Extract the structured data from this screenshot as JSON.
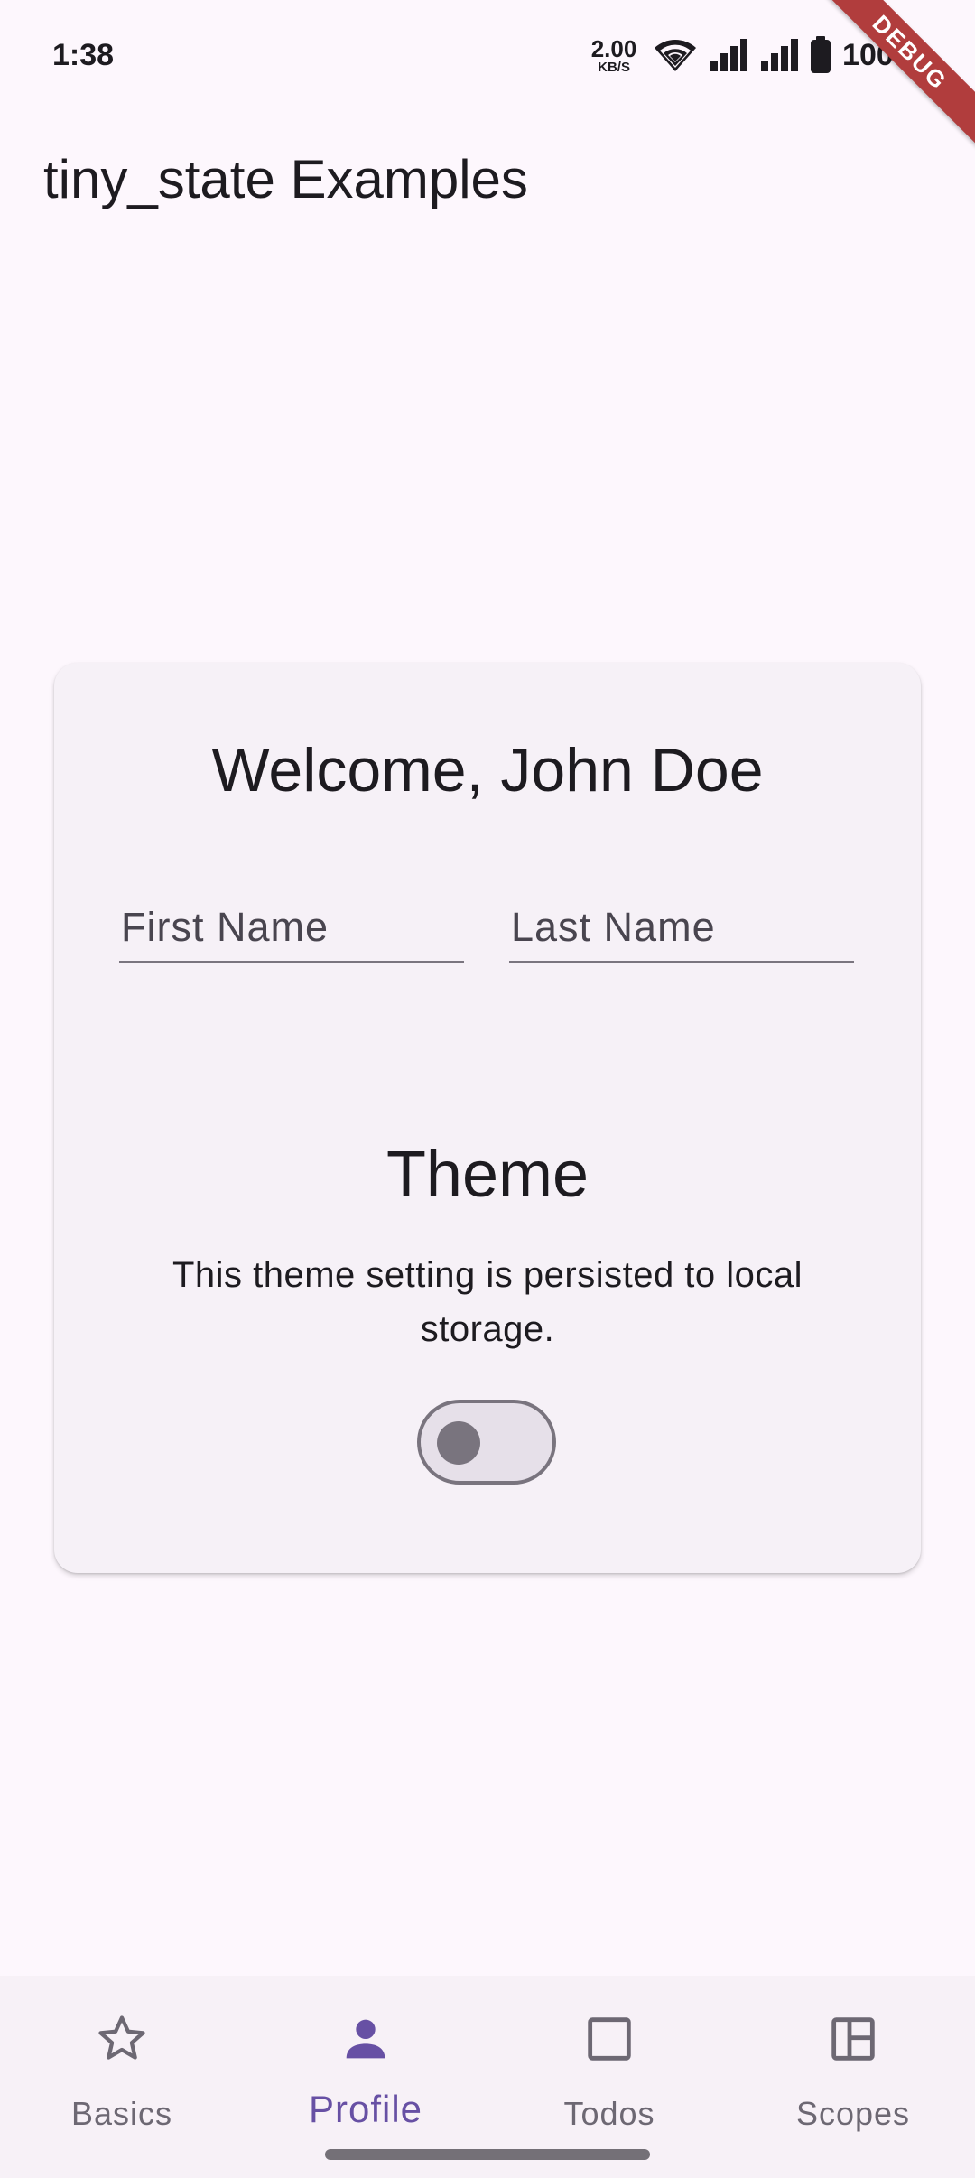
{
  "status_bar": {
    "time": "1:38",
    "net_speed_value": "2.00",
    "net_speed_unit": "KB/S",
    "battery": "100%",
    "icons": [
      "wifi-icon",
      "signal-icon",
      "signal-icon",
      "battery-icon"
    ]
  },
  "debug_banner": "DEBUG",
  "app_bar": {
    "title": "tiny_state Examples"
  },
  "profile_card": {
    "welcome": "Welcome, John Doe",
    "first_name": {
      "placeholder": "First Name",
      "value": ""
    },
    "last_name": {
      "placeholder": "Last Name",
      "value": ""
    },
    "theme_title": "Theme",
    "theme_description": "This theme setting is persisted to local storage.",
    "theme_toggle_on": false
  },
  "bottom_nav": {
    "items": [
      {
        "label": "Basics",
        "icon": "star-outline-icon",
        "active": false
      },
      {
        "label": "Profile",
        "icon": "person-icon",
        "active": true
      },
      {
        "label": "Todos",
        "icon": "square-outline-icon",
        "active": false
      },
      {
        "label": "Scopes",
        "icon": "dashboard-outline-icon",
        "active": false
      }
    ]
  },
  "colors": {
    "background": "#fdf7fd",
    "card": "#f6f1f7",
    "accent": "#6750a4",
    "inactive": "#6d6873",
    "outline": "#79747e",
    "debug_banner": "#b13d3d"
  }
}
